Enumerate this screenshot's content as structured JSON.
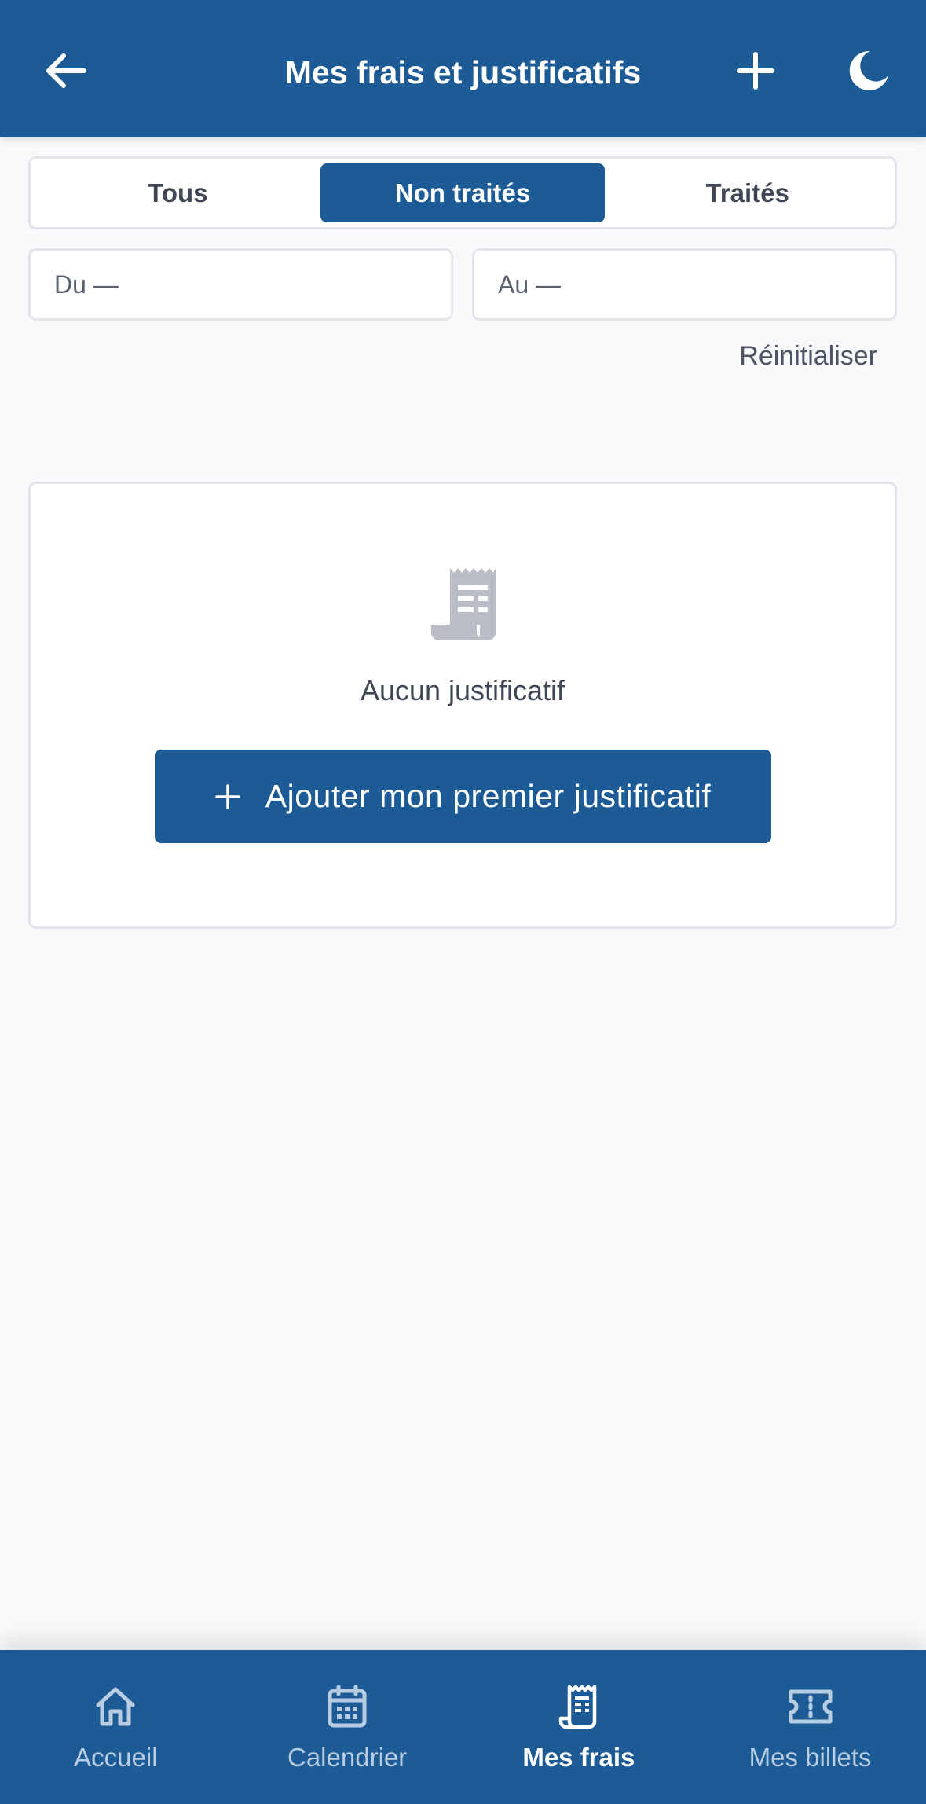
{
  "header": {
    "title": "Mes frais et justificatifs",
    "back_icon": "arrow-left-icon",
    "add_icon": "plus-icon",
    "theme_icon": "moon-icon"
  },
  "filters": {
    "tabs": [
      {
        "label": "Tous",
        "active": false
      },
      {
        "label": "Non traités",
        "active": true
      },
      {
        "label": "Traités",
        "active": false
      }
    ],
    "date_from": "Du —",
    "date_to": "Au —",
    "reset_label": "Réinitialiser"
  },
  "empty_state": {
    "icon": "receipt-icon",
    "message": "Aucun justificatif",
    "button_label": "Ajouter mon premier justificatif"
  },
  "bottom_nav": {
    "items": [
      {
        "label": "Accueil",
        "icon": "home-icon",
        "active": false
      },
      {
        "label": "Calendrier",
        "icon": "calendar-icon",
        "active": false
      },
      {
        "label": "Mes frais",
        "icon": "receipt-icon",
        "active": true
      },
      {
        "label": "Mes billets",
        "icon": "ticket-icon",
        "active": false
      }
    ]
  },
  "colors": {
    "primary": "#1c5b96",
    "background": "#f8f9fb",
    "muted_icon": "#b9bdc6"
  }
}
